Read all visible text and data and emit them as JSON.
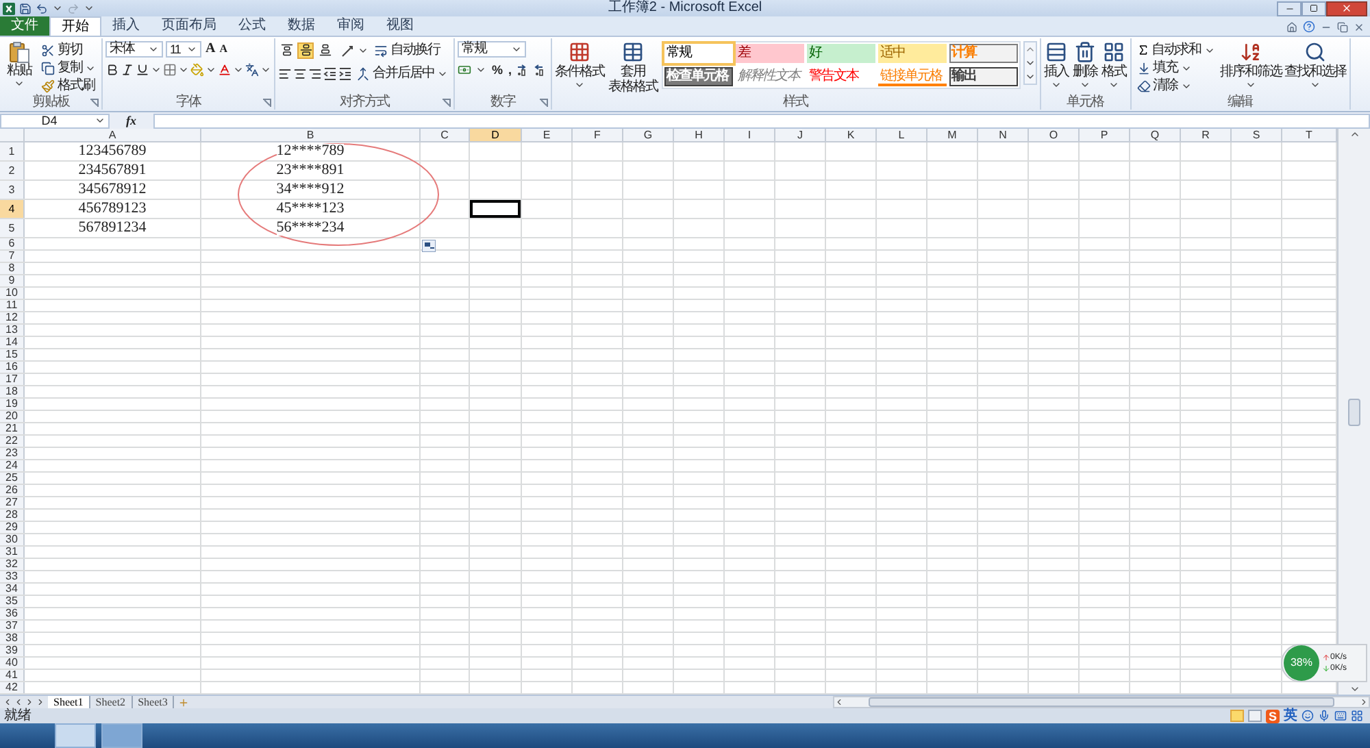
{
  "window": {
    "title": "工作簿2 - Microsoft Excel"
  },
  "ribbon_tabs": [
    {
      "label": "文件",
      "kind": "file",
      "selected": false
    },
    {
      "label": "开始",
      "kind": "tab",
      "selected": true
    },
    {
      "label": "插入",
      "kind": "tab",
      "selected": false
    },
    {
      "label": "页面布局",
      "kind": "tab",
      "selected": false
    },
    {
      "label": "公式",
      "kind": "tab",
      "selected": false
    },
    {
      "label": "数据",
      "kind": "tab",
      "selected": false
    },
    {
      "label": "审阅",
      "kind": "tab",
      "selected": false
    },
    {
      "label": "视图",
      "kind": "tab",
      "selected": false
    }
  ],
  "clipboard": {
    "label": "剪贴板",
    "paste": "粘贴",
    "cut": "剪切",
    "copy": "复制",
    "format_painter": "格式刷"
  },
  "font": {
    "label": "字体",
    "family": "宋体",
    "size": "11",
    "grow": "A",
    "shrink": "A"
  },
  "alignment": {
    "label": "对齐方式",
    "wrap": "自动换行",
    "merge": "合并后居中",
    "vertical_align": [
      {
        "kind": "top",
        "selected": false
      },
      {
        "kind": "middle",
        "selected": true
      },
      {
        "kind": "bottom",
        "selected": false
      }
    ]
  },
  "number": {
    "label": "数字",
    "format": "常规",
    "buttons": [
      "%",
      ","
    ]
  },
  "styles": {
    "label": "样式",
    "conditional": "条件格式",
    "table_format": [
      "套用",
      "表格格式"
    ],
    "gallery": [
      {
        "label": "常规",
        "kind": "normal",
        "color": "#ffffff",
        "selected": true
      },
      {
        "label": "差",
        "kind": "bad",
        "color": "#ffc7ce",
        "selected": false
      },
      {
        "label": "好",
        "kind": "good",
        "color": "#c6efce",
        "selected": false
      },
      {
        "label": "适中",
        "kind": "neutral",
        "color": "#ffeb9c",
        "selected": false
      },
      {
        "label": "计算",
        "kind": "calc",
        "color": "#f2f2f2",
        "selected": false
      },
      {
        "label": "检查单元格",
        "kind": "check",
        "color": "#7a7a7a",
        "selected": false
      },
      {
        "label": "解释性文本",
        "kind": "explanatory",
        "color": "#ffffff",
        "selected": false
      },
      {
        "label": "警告文本",
        "kind": "warning",
        "color": "#ffffff",
        "selected": false
      },
      {
        "label": "链接单元格",
        "kind": "linked",
        "color": "#ffffff",
        "selected": false
      },
      {
        "label": "输出",
        "kind": "output",
        "color": "#f2f2f2",
        "selected": false
      }
    ]
  },
  "cells": {
    "label": "单元格",
    "insert": "插入",
    "delete": "删除",
    "format": "格式"
  },
  "editing": {
    "label": "编辑",
    "autosum": "自动求和",
    "fill": "填充",
    "clear": "清除",
    "sort": "排序和筛选",
    "find": "查找和选择"
  },
  "formula_bar": {
    "name_box": "D4",
    "fx": "fx"
  },
  "sheet": {
    "columns": [
      {
        "label": "A",
        "selected": false
      },
      {
        "label": "B",
        "selected": false
      },
      {
        "label": "C",
        "selected": false
      },
      {
        "label": "D",
        "selected": true
      },
      {
        "label": "E",
        "selected": false
      },
      {
        "label": "F",
        "selected": false
      },
      {
        "label": "G",
        "selected": false
      },
      {
        "label": "H",
        "selected": false
      },
      {
        "label": "I",
        "selected": false
      },
      {
        "label": "J",
        "selected": false
      },
      {
        "label": "K",
        "selected": false
      },
      {
        "label": "L",
        "selected": false
      },
      {
        "label": "M",
        "selected": false
      },
      {
        "label": "N",
        "selected": false
      },
      {
        "label": "O",
        "selected": false
      },
      {
        "label": "P",
        "selected": false
      },
      {
        "label": "Q",
        "selected": false
      },
      {
        "label": "R",
        "selected": false
      },
      {
        "label": "S",
        "selected": false
      },
      {
        "label": "T",
        "selected": false
      }
    ],
    "rows": [
      {
        "number": "1",
        "selected": false,
        "cells": [
          "123456789",
          "12****789"
        ]
      },
      {
        "number": "2",
        "selected": false,
        "cells": [
          "234567891",
          "23****891"
        ]
      },
      {
        "number": "3",
        "selected": false,
        "cells": [
          "345678912",
          "34****912"
        ]
      },
      {
        "number": "4",
        "selected": true,
        "cells": [
          "456789123",
          "45****123"
        ]
      },
      {
        "number": "5",
        "selected": false,
        "cells": [
          "567891234",
          "56****234"
        ]
      },
      {
        "number": "6",
        "selected": false
      },
      {
        "number": "7",
        "selected": false
      },
      {
        "number": "8",
        "selected": false
      },
      {
        "number": "9",
        "selected": false
      },
      {
        "number": "10",
        "selected": false
      },
      {
        "number": "11",
        "selected": false
      },
      {
        "number": "12",
        "selected": false
      },
      {
        "number": "13",
        "selected": false
      },
      {
        "number": "14",
        "selected": false
      },
      {
        "number": "15",
        "selected": false
      },
      {
        "number": "16",
        "selected": false
      },
      {
        "number": "17",
        "selected": false
      },
      {
        "number": "18",
        "selected": false
      },
      {
        "number": "19",
        "selected": false
      },
      {
        "number": "20",
        "selected": false
      },
      {
        "number": "21",
        "selected": false
      },
      {
        "number": "22",
        "selected": false
      },
      {
        "number": "23",
        "selected": false
      },
      {
        "number": "24",
        "selected": false
      },
      {
        "number": "25",
        "selected": false
      },
      {
        "number": "26",
        "selected": false
      },
      {
        "number": "27",
        "selected": false
      },
      {
        "number": "28",
        "selected": false
      },
      {
        "number": "29",
        "selected": false
      },
      {
        "number": "30",
        "selected": false
      },
      {
        "number": "31",
        "selected": false
      },
      {
        "number": "32",
        "selected": false
      },
      {
        "number": "33",
        "selected": false
      },
      {
        "number": "34",
        "selected": false
      },
      {
        "number": "35",
        "selected": false
      },
      {
        "number": "36",
        "selected": false
      },
      {
        "number": "37",
        "selected": false
      },
      {
        "number": "38",
        "selected": false
      },
      {
        "number": "39",
        "selected": false
      },
      {
        "number": "40",
        "selected": false
      },
      {
        "number": "41",
        "selected": false
      },
      {
        "number": "42",
        "selected": false
      }
    ]
  },
  "sheet_tabs": [
    {
      "label": "Sheet1",
      "selected": true
    },
    {
      "label": "Sheet2",
      "selected": false
    },
    {
      "label": "Sheet3",
      "selected": false
    }
  ],
  "status_bar": {
    "text": "就绪",
    "ime": {
      "logo": "S",
      "mode": "英"
    }
  },
  "net_widget": {
    "percent": "38%",
    "up": "0K/s",
    "down": "0K/s"
  }
}
